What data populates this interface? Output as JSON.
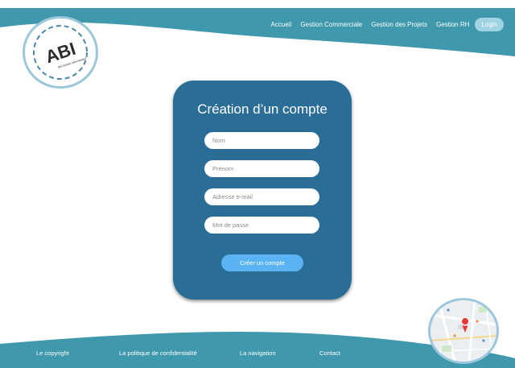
{
  "header": {
    "nav": [
      "Accueil",
      "Gestion Commerciale",
      "Gestion des Projets",
      "Gestion RH"
    ],
    "login_label": "Login"
  },
  "logo": {
    "text": "ABI",
    "tagline": "Abi bureau informatique"
  },
  "form": {
    "title": "Création d’un compte",
    "fields": {
      "nom": "Nom",
      "prenom": "Prénom",
      "email": "Adresse e-mail",
      "password": "Mot de passe"
    },
    "submit_label": "Créer un compte"
  },
  "footer": {
    "links": [
      "Le copyright",
      "La politique de confidentialité",
      "La navigation",
      "Contact"
    ]
  },
  "colors": {
    "header_teal": "#3f98ab",
    "card_blue": "#2a6d96",
    "button_blue": "#5ab4f3",
    "login_pill": "#9fd3e3"
  },
  "icons": {
    "map_marker": "map-pin-icon"
  }
}
